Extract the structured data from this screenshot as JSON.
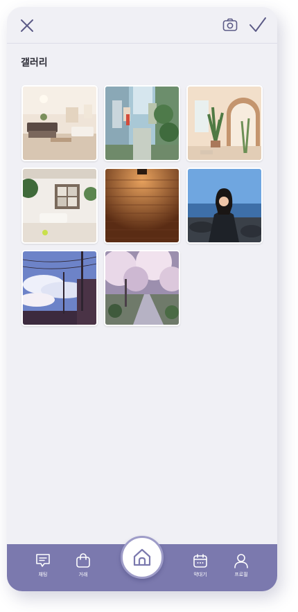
{
  "screen": {
    "title": "갤러리"
  },
  "header": {
    "close_icon": "close-icon",
    "camera_icon": "camera-icon",
    "confirm_icon": "check-icon"
  },
  "gallery": {
    "photos": [
      {
        "name": "photo-interior-lounge",
        "description_icon": "image"
      },
      {
        "name": "photo-alley-street",
        "description_icon": "image"
      },
      {
        "name": "photo-arched-doorway-plant",
        "description_icon": "image"
      },
      {
        "name": "photo-white-room-window",
        "description_icon": "image"
      },
      {
        "name": "photo-brick-wall-light",
        "description_icon": "image"
      },
      {
        "name": "photo-woman-seaside",
        "description_icon": "image"
      },
      {
        "name": "photo-sky-powerlines",
        "description_icon": "image"
      },
      {
        "name": "photo-cherry-blossom-street",
        "description_icon": "image"
      }
    ]
  },
  "nav": {
    "items": [
      {
        "label": "채팅",
        "icon": "chat-icon"
      },
      {
        "label": "거래",
        "icon": "shopping-bag-icon"
      },
      {
        "label": "",
        "icon": "home-icon"
      },
      {
        "label": "약대기",
        "icon": "calendar-icon"
      },
      {
        "label": "프로필",
        "icon": "user-icon"
      }
    ]
  },
  "colors": {
    "accent": "#7b79ae",
    "icon": "#5b5a86",
    "background": "#f0f0f5"
  }
}
